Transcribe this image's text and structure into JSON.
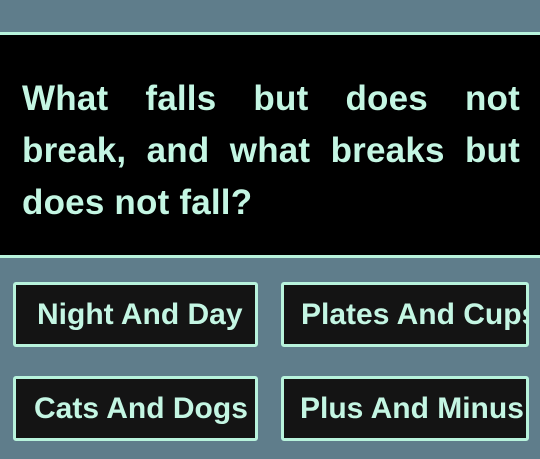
{
  "question": {
    "text": "What falls but does not break, and what breaks but does not fall?"
  },
  "answers": [
    {
      "label": "Night And Day"
    },
    {
      "label": "Plates And Cups"
    },
    {
      "label": "Cats And Dogs"
    },
    {
      "label": "Plus And Minus"
    }
  ],
  "colors": {
    "background": "#5f7d8b",
    "panel": "#000000",
    "accent": "#b8f3dc",
    "text": "#c4f6e3",
    "button": "#141414"
  }
}
